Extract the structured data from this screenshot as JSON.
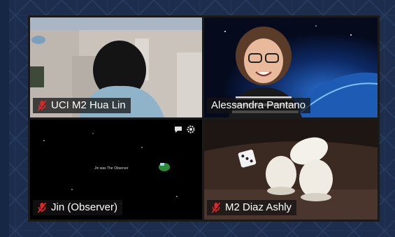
{
  "participants": [
    {
      "name": "UCI M2 Hua Lin",
      "muted": true
    },
    {
      "name": "Alessandra Pantano",
      "muted": false
    },
    {
      "name": "Jin (Observer)",
      "muted": true
    },
    {
      "name": "M2 Diaz Ashly",
      "muted": true
    }
  ],
  "game_screen": {
    "caption": "Jin was The Observer"
  },
  "icons": {
    "mute": "microphone-muted-icon",
    "chat": "chat-bubble-icon",
    "settings": "gear-icon"
  },
  "colors": {
    "background": "#1c2d4d",
    "mute_red": "#e02828",
    "name_tag_bg": "#141414"
  }
}
